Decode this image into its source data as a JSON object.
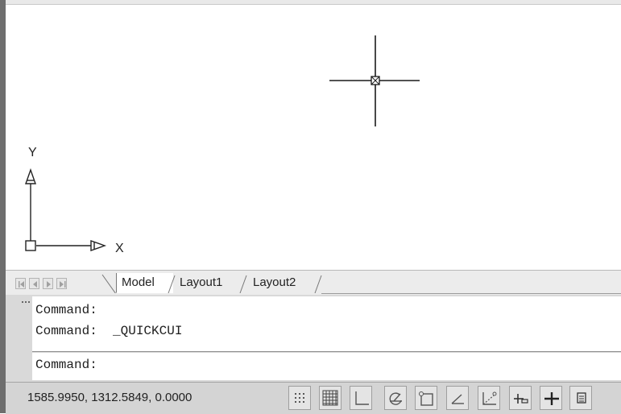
{
  "tabs": {
    "model": "Model",
    "layout1": "Layout1",
    "layout2": "Layout2"
  },
  "ucs": {
    "x_label": "X",
    "y_label": "Y"
  },
  "command": {
    "history": [
      "Command:",
      "Command:  _QUICKCUI"
    ],
    "prompt": "Command:"
  },
  "status": {
    "coordinates": "1585.9950, 1312.5849, 0.0000",
    "buttons": [
      "snap-icon",
      "grid-icon",
      "ortho-icon",
      "polar-icon",
      "osnap-icon",
      "otrack-icon",
      "ducs-icon",
      "dyn-icon",
      "lwt-icon",
      "model-icon"
    ]
  },
  "colors": {
    "frame": "#6e6e6e",
    "crosshair": "#1a1a1a",
    "statusbar": "#d4d4d4"
  }
}
